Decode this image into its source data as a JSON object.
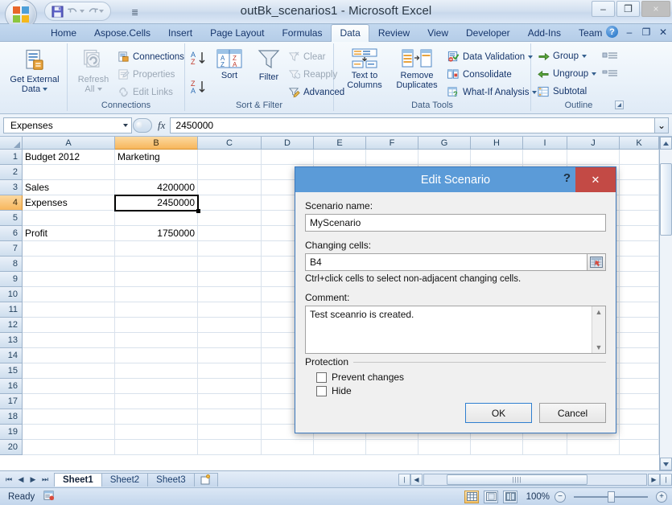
{
  "window": {
    "title": "outBk_scenarios1 - Microsoft Excel",
    "minimize": "–",
    "maximize": "❐",
    "close": "×"
  },
  "quick_access": {
    "save": "save-icon",
    "undo": "↶",
    "redo": "↷",
    "more": "☰"
  },
  "ribbon": {
    "tabs": [
      {
        "label": "Home",
        "active": false
      },
      {
        "label": "Aspose.Cells",
        "active": false
      },
      {
        "label": "Insert",
        "active": false
      },
      {
        "label": "Page Layout",
        "active": false
      },
      {
        "label": "Formulas",
        "active": false
      },
      {
        "label": "Data",
        "active": true
      },
      {
        "label": "Review",
        "active": false
      },
      {
        "label": "View",
        "active": false
      },
      {
        "label": "Developer",
        "active": false
      },
      {
        "label": "Add-Ins",
        "active": false
      },
      {
        "label": "Team",
        "active": false
      }
    ],
    "help": "?",
    "minimize_ribbon": "–",
    "restore_window": "❐",
    "close_window": "✕",
    "groups": {
      "get_external_data": {
        "title": "",
        "button": "Get External\nData",
        "line1": "Get External",
        "line2": "Data"
      },
      "connections": {
        "title": "Connections",
        "refresh_all_line1": "Refresh",
        "refresh_all_line2": "All",
        "connections": "Connections",
        "properties": "Properties",
        "edit_links": "Edit Links"
      },
      "sort_filter": {
        "title": "Sort & Filter",
        "sort_asc": "A↓Z",
        "sort_desc": "Z↓A",
        "sort": "Sort",
        "filter": "Filter",
        "clear": "Clear",
        "reapply": "Reapply",
        "advanced": "Advanced"
      },
      "data_tools": {
        "title": "Data Tools",
        "text_to_columns_l1": "Text to",
        "text_to_columns_l2": "Columns",
        "remove_duplicates_l1": "Remove",
        "remove_duplicates_l2": "Duplicates",
        "data_validation": "Data Validation",
        "consolidate": "Consolidate",
        "what_if": "What-If Analysis"
      },
      "outline": {
        "title": "Outline",
        "group": "Group",
        "ungroup": "Ungroup",
        "subtotal": "Subtotal"
      }
    }
  },
  "formula_bar": {
    "name_box": "Expenses",
    "fx": "fx",
    "value": "2450000",
    "expand": "⌄"
  },
  "grid": {
    "columns": [
      "A",
      "B",
      "C",
      "D",
      "E",
      "F",
      "G",
      "H",
      "I",
      "J",
      "K"
    ],
    "selected_column": "B",
    "rows": [
      1,
      2,
      3,
      4,
      5,
      6,
      7,
      8,
      9,
      10,
      11,
      12,
      13,
      14,
      15,
      16,
      17,
      18,
      19,
      20
    ],
    "selected_row": 4,
    "cells": [
      {
        "row": 1,
        "col": "A",
        "value": "Budget 2012",
        "align": "left"
      },
      {
        "row": 1,
        "col": "B",
        "value": "Marketing",
        "align": "left"
      },
      {
        "row": 3,
        "col": "A",
        "value": "Sales",
        "align": "left"
      },
      {
        "row": 3,
        "col": "B",
        "value": "4200000",
        "align": "right"
      },
      {
        "row": 4,
        "col": "A",
        "value": "Expenses",
        "align": "left"
      },
      {
        "row": 4,
        "col": "B",
        "value": "2450000",
        "align": "right"
      },
      {
        "row": 6,
        "col": "A",
        "value": "Profit",
        "align": "left"
      },
      {
        "row": 6,
        "col": "B",
        "value": "1750000",
        "align": "right"
      }
    ],
    "active_cell": "B4"
  },
  "sheet_tabs": {
    "first": "⏮",
    "prev": "◀",
    "next": "▶",
    "last": "⏭",
    "tabs": [
      {
        "label": "Sheet1",
        "active": true
      },
      {
        "label": "Sheet2",
        "active": false
      },
      {
        "label": "Sheet3",
        "active": false
      }
    ],
    "insert_sheet": "insert-sheet-icon"
  },
  "status_bar": {
    "status": "Ready",
    "record_macro": "record-macro-icon",
    "view_normal": "normal-view-icon",
    "view_page_layout": "page-layout-view-icon",
    "view_page_break": "page-break-view-icon",
    "zoom": "100%",
    "zoom_out": "−",
    "zoom_in": "+"
  },
  "dialog": {
    "title": "Edit Scenario",
    "help": "?",
    "close": "✕",
    "scenario_name_label": "Scenario name:",
    "scenario_name_value": "MyScenario",
    "changing_cells_label": "Changing cells:",
    "changing_cells_value": "B4",
    "picker_icon": "range-picker-icon",
    "hint": "Ctrl+click cells to select non-adjacent changing cells.",
    "comment_label": "Comment:",
    "comment_value": "Test sceanrio is created.",
    "scroll_up": "▲",
    "scroll_down": "▼",
    "protection_legend": "Protection",
    "prevent_changes_label": "Prevent changes",
    "prevent_changes_checked": false,
    "hide_label": "Hide",
    "hide_checked": false,
    "ok_label": "OK",
    "cancel_label": "Cancel"
  },
  "colors": {
    "dialog_title_bg": "#5b9bd8",
    "dialog_close_bg": "#c34a45",
    "selected_header": "#f7b65c",
    "ribbon_text": "#15356b"
  }
}
